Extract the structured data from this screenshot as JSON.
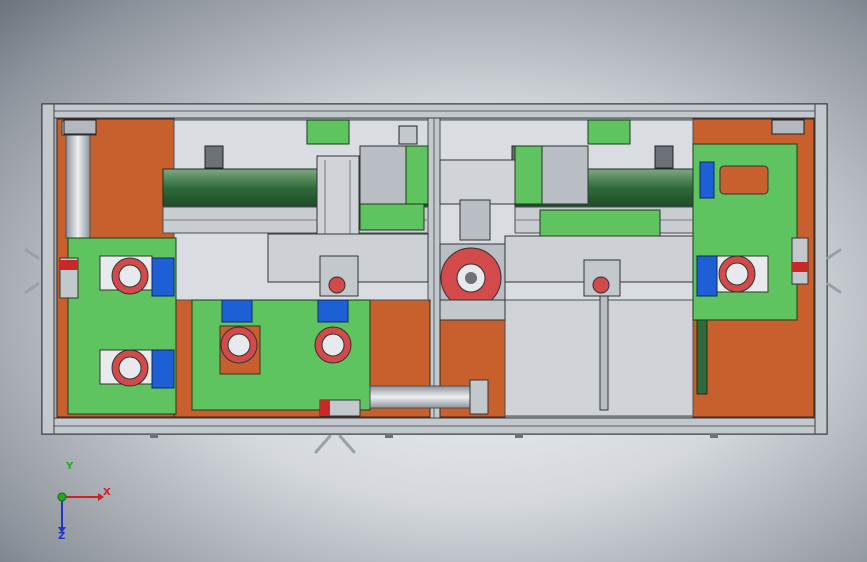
{
  "view": {
    "type": "cad-assembly-top-view",
    "colors": {
      "background": "#c9ced3",
      "copper_plate": "#c8602e",
      "green_plate": "#5fc45f",
      "blue_block": "#1e5fd6",
      "red_roller": "#d24a4a",
      "steel": "#b9bec4",
      "dark_steel": "#6c7278",
      "rail": "#2e6a3b"
    }
  },
  "triad": {
    "x_label": "X",
    "y_label": "Y",
    "z_label": "Z",
    "x_color": "#cc2222",
    "y_color": "#22aa22",
    "z_color": "#2233cc"
  }
}
